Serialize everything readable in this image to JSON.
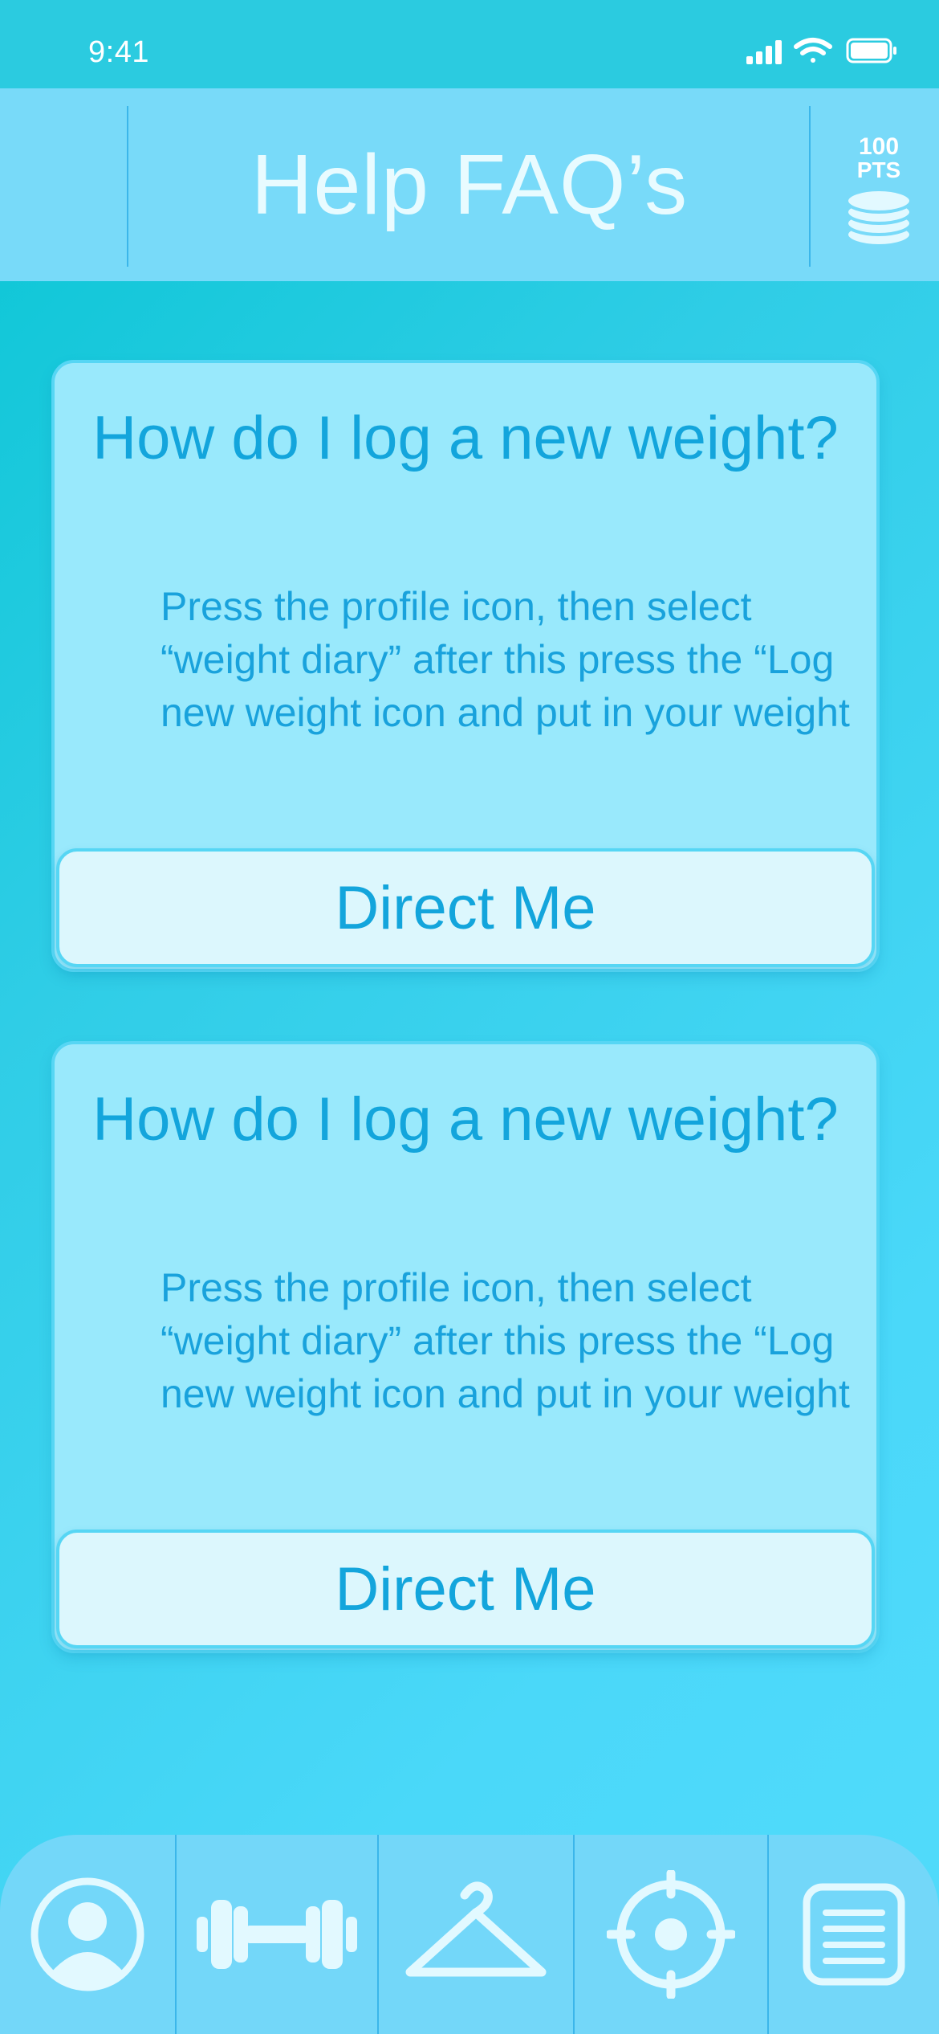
{
  "status_bar": {
    "time": "9:41"
  },
  "header": {
    "title": "Help FAQ’s",
    "points_value": "100",
    "points_unit": "PTS"
  },
  "faqs": [
    {
      "question": "How do I log a new weight?",
      "answer": "Press the profile icon, then select “weight diary” after this press the “Log new weight icon and put in your weight",
      "button_label": "Direct Me"
    },
    {
      "question": "How do I log a new weight?",
      "answer": "Press the profile icon, then select “weight diary” after this press the “Log new weight icon and put in your weight",
      "button_label": "Direct Me"
    }
  ],
  "bottom_nav": {
    "items": [
      {
        "icon": "profile-icon"
      },
      {
        "icon": "dumbbell-icon"
      },
      {
        "icon": "hanger-icon"
      },
      {
        "icon": "target-icon"
      },
      {
        "icon": "list-icon"
      }
    ]
  },
  "colors": {
    "background_start": "#07c5d3",
    "background_end": "#52dbfb",
    "header": "#78daf9",
    "card": "#99e9fc",
    "button": "#dcf7fd",
    "accent_text": "#13a5dc",
    "divider": "#3bb6ea"
  }
}
